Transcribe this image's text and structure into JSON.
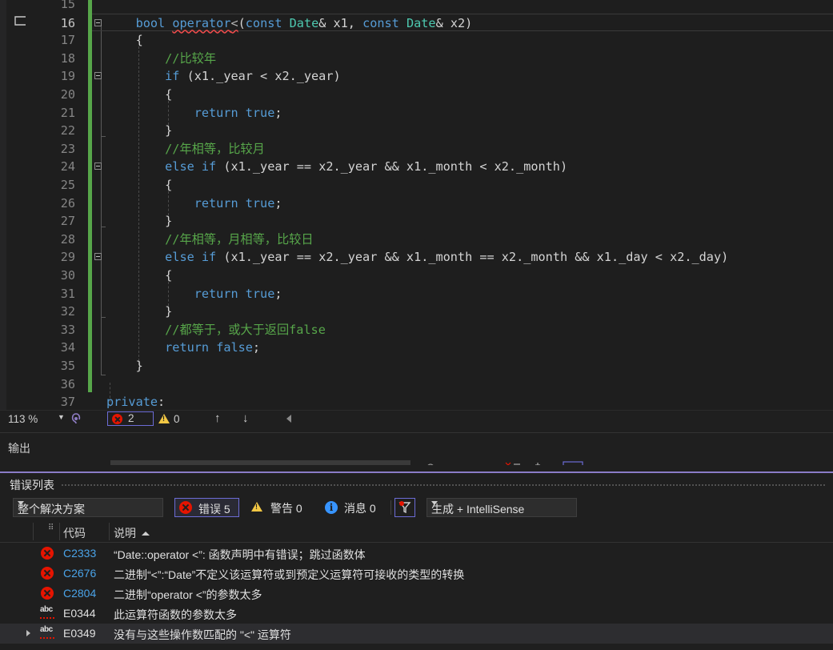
{
  "editor": {
    "lines": [
      {
        "num": "15",
        "tokens": []
      },
      {
        "num": "16",
        "current": true,
        "fold": true,
        "tokens": [
          {
            "t": "    ",
            "c": "pl"
          },
          {
            "t": "bool",
            "c": "kw"
          },
          {
            "t": " ",
            "c": "pl"
          },
          {
            "t": "operator",
            "c": "kw squig"
          },
          {
            "t": "<",
            "c": "op squig"
          },
          {
            "t": "(",
            "c": "pl"
          },
          {
            "t": "const",
            "c": "kw"
          },
          {
            "t": " ",
            "c": "pl"
          },
          {
            "t": "Date",
            "c": "ty"
          },
          {
            "t": "& x1, ",
            "c": "pl"
          },
          {
            "t": "const",
            "c": "kw"
          },
          {
            "t": " ",
            "c": "pl"
          },
          {
            "t": "Date",
            "c": "ty"
          },
          {
            "t": "& x2)",
            "c": "pl"
          }
        ]
      },
      {
        "num": "17",
        "tokens": [
          {
            "t": "    {",
            "c": "pl"
          }
        ]
      },
      {
        "num": "18",
        "tokens": [
          {
            "t": "        ",
            "c": "pl"
          },
          {
            "t": "//比较年",
            "c": "cm"
          }
        ]
      },
      {
        "num": "19",
        "fold": true,
        "tokens": [
          {
            "t": "        ",
            "c": "pl"
          },
          {
            "t": "if",
            "c": "kw"
          },
          {
            "t": " (x1._year < x2._year)",
            "c": "pl"
          }
        ]
      },
      {
        "num": "20",
        "tokens": [
          {
            "t": "        {",
            "c": "pl"
          }
        ]
      },
      {
        "num": "21",
        "tokens": [
          {
            "t": "            ",
            "c": "pl"
          },
          {
            "t": "return",
            "c": "kw"
          },
          {
            "t": " ",
            "c": "pl"
          },
          {
            "t": "true",
            "c": "kw"
          },
          {
            "t": ";",
            "c": "pl"
          }
        ]
      },
      {
        "num": "22",
        "tokens": [
          {
            "t": "        }",
            "c": "pl"
          }
        ]
      },
      {
        "num": "23",
        "tokens": [
          {
            "t": "        ",
            "c": "pl"
          },
          {
            "t": "//年相等，比较月",
            "c": "cm"
          }
        ]
      },
      {
        "num": "24",
        "fold": true,
        "tokens": [
          {
            "t": "        ",
            "c": "pl"
          },
          {
            "t": "else",
            "c": "kw"
          },
          {
            "t": " ",
            "c": "pl"
          },
          {
            "t": "if",
            "c": "kw"
          },
          {
            "t": " (x1._year == x2._year && x1._month < x2._month)",
            "c": "pl"
          }
        ]
      },
      {
        "num": "25",
        "tokens": [
          {
            "t": "        {",
            "c": "pl"
          }
        ]
      },
      {
        "num": "26",
        "tokens": [
          {
            "t": "            ",
            "c": "pl"
          },
          {
            "t": "return",
            "c": "kw"
          },
          {
            "t": " ",
            "c": "pl"
          },
          {
            "t": "true",
            "c": "kw"
          },
          {
            "t": ";",
            "c": "pl"
          }
        ]
      },
      {
        "num": "27",
        "tokens": [
          {
            "t": "        }",
            "c": "pl"
          }
        ]
      },
      {
        "num": "28",
        "tokens": [
          {
            "t": "        ",
            "c": "pl"
          },
          {
            "t": "//年相等，月相等，比较日",
            "c": "cm"
          }
        ]
      },
      {
        "num": "29",
        "fold": true,
        "tokens": [
          {
            "t": "        ",
            "c": "pl"
          },
          {
            "t": "else",
            "c": "kw"
          },
          {
            "t": " ",
            "c": "pl"
          },
          {
            "t": "if",
            "c": "kw"
          },
          {
            "t": " (x1._year == x2._year && x1._month == x2._month && x1._day < x2._day)",
            "c": "pl"
          }
        ]
      },
      {
        "num": "30",
        "tokens": [
          {
            "t": "        {",
            "c": "pl"
          }
        ]
      },
      {
        "num": "31",
        "tokens": [
          {
            "t": "            ",
            "c": "pl"
          },
          {
            "t": "return",
            "c": "kw"
          },
          {
            "t": " ",
            "c": "pl"
          },
          {
            "t": "true",
            "c": "kw"
          },
          {
            "t": ";",
            "c": "pl"
          }
        ]
      },
      {
        "num": "32",
        "tokens": [
          {
            "t": "        }",
            "c": "pl"
          }
        ]
      },
      {
        "num": "33",
        "tokens": [
          {
            "t": "        ",
            "c": "pl"
          },
          {
            "t": "//都等于，或大于返回false",
            "c": "cm"
          }
        ]
      },
      {
        "num": "34",
        "tokens": [
          {
            "t": "        ",
            "c": "pl"
          },
          {
            "t": "return",
            "c": "kw"
          },
          {
            "t": " ",
            "c": "pl"
          },
          {
            "t": "false",
            "c": "kw"
          },
          {
            "t": ";",
            "c": "pl"
          }
        ]
      },
      {
        "num": "35",
        "tokens": [
          {
            "t": "    }",
            "c": "pl"
          }
        ]
      },
      {
        "num": "36",
        "tokens": []
      },
      {
        "num": "37",
        "tokens": [
          {
            "t": "private",
            "c": "kw"
          },
          {
            "t": ":",
            "c": "pl"
          }
        ]
      }
    ]
  },
  "status": {
    "zoom": "113 %",
    "error_count": "2",
    "warning_count": "0"
  },
  "output": {
    "title": "输出"
  },
  "error_list": {
    "title": "错误列表",
    "scope": "整个解决方案",
    "filter_errors": "错误 5",
    "filter_warnings": "警告 0",
    "filter_messages": "消息 0",
    "build_source": "生成 + IntelliSense",
    "columns": {
      "code": "代码",
      "description": "说明"
    },
    "rows": [
      {
        "icon": "error",
        "code": "C2333",
        "desc": "“Date::operator <”: 函数声明中有错误；跳过函数体"
      },
      {
        "icon": "error",
        "code": "C2676",
        "desc": "二进制“<”:“Date”不定义该运算符或到预定义运算符可接收的类型的转换"
      },
      {
        "icon": "error",
        "code": "C2804",
        "desc": "二进制“operator <”的参数太多"
      },
      {
        "icon": "intellisense",
        "code": "E0344",
        "desc": "此运算符函数的参数太多"
      },
      {
        "icon": "intellisense",
        "code": "E0349",
        "desc": "没有与这些操作数匹配的 \"<\" 运算符",
        "selected": true,
        "expandable": true
      }
    ]
  },
  "colors": {
    "change_bar": "#57a64a",
    "keyword": "#569cd6",
    "type": "#4ec9b0",
    "comment": "#57a64a",
    "error": "#e51400",
    "link": "#4aa3e8",
    "accent": "#8a7cc7"
  }
}
